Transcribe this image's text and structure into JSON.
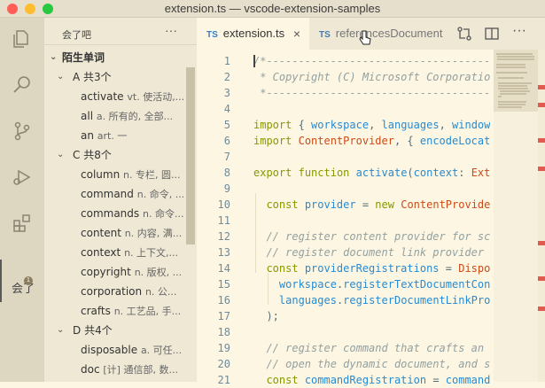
{
  "window": {
    "title": "extension.ts — vscode-extension-samples"
  },
  "activity_bar": {
    "active_badge_label": "会了",
    "badge_count": "1"
  },
  "sidebar": {
    "header": "会了吧",
    "more": "···",
    "section": "陌生单词",
    "groups": [
      {
        "letter": "A",
        "count": "共3个",
        "items": [
          {
            "word": "activate",
            "def": "vt. 使活动,..."
          },
          {
            "word": "all",
            "def": "a. 所有的, 全部..."
          },
          {
            "word": "an",
            "def": "art. 一"
          }
        ]
      },
      {
        "letter": "C",
        "count": "共8个",
        "items": [
          {
            "word": "column",
            "def": "n. 专栏, 圆..."
          },
          {
            "word": "command",
            "def": "n. 命令, ..."
          },
          {
            "word": "commands",
            "def": "n. 命令..."
          },
          {
            "word": "content",
            "def": "n. 内容, 满..."
          },
          {
            "word": "context",
            "def": "n. 上下文,..."
          },
          {
            "word": "copyright",
            "def": "n. 版权, ..."
          },
          {
            "word": "corporation",
            "def": "n. 公..."
          },
          {
            "word": "crafts",
            "def": "n. 工艺品, 手..."
          }
        ]
      },
      {
        "letter": "D",
        "count": "共4个",
        "items": [
          {
            "word": "disposable",
            "def": "a. 可任..."
          },
          {
            "word": "doc",
            "def": "[计] 通信部, 数..."
          }
        ]
      }
    ]
  },
  "tabs": [
    {
      "badge": "TS",
      "label": "extension.ts",
      "close": "×"
    },
    {
      "badge": "TS",
      "label": "referencesDocument"
    }
  ],
  "code_lines": [
    {
      "n": "1",
      "t": "/*---------------------------------------------------------"
    },
    {
      "n": "2",
      "t": " * Copyright (C) Microsoft Corporation. All rights reserved."
    },
    {
      "n": "3",
      "t": " *--------------------------------------------------------*/"
    },
    {
      "n": "4",
      "t": ""
    },
    {
      "n": "5",
      "t": "import { workspace, languages, window, commands"
    },
    {
      "n": "6",
      "t": "import ContentProvider, { encodeLocation } from"
    },
    {
      "n": "7",
      "t": ""
    },
    {
      "n": "8",
      "t": "export function activate(context: ExtensionContext"
    },
    {
      "n": "9",
      "t": ""
    },
    {
      "n": "10",
      "t": "  const provider = new ContentProvider();"
    },
    {
      "n": "11",
      "t": ""
    },
    {
      "n": "12",
      "t": "  // register content provider for scheme `references`"
    },
    {
      "n": "13",
      "t": "  // register document link provider for scheme"
    },
    {
      "n": "14",
      "t": "  const providerRegistrations = Disposable.from("
    },
    {
      "n": "15",
      "t": "    workspace.registerTextDocumentContentProvider"
    },
    {
      "n": "16",
      "t": "    languages.registerDocumentLinkProvider("
    },
    {
      "n": "17",
      "t": "  );"
    },
    {
      "n": "18",
      "t": ""
    },
    {
      "n": "19",
      "t": "  // register command that crafts an uri with"
    },
    {
      "n": "20",
      "t": "  // open the dynamic document, and shows it"
    },
    {
      "n": "21",
      "t": "  const commandRegistration = commands."
    }
  ]
}
